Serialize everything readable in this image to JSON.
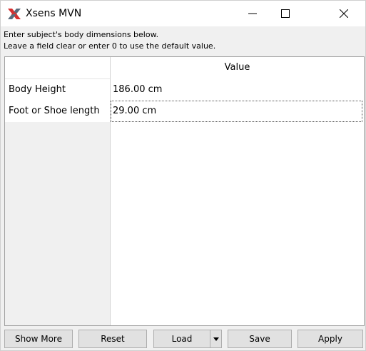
{
  "window": {
    "title": "Xsens MVN",
    "logo_icon": "xsens-x-logo",
    "controls": [
      "minimize-icon",
      "maximize-icon",
      "close-icon"
    ]
  },
  "instructions": {
    "line1": "Enter subject's body dimensions below.",
    "line2": "Leave a field clear or enter 0 to use the default value."
  },
  "table": {
    "column_header": "Value",
    "rows": [
      {
        "label": "Body Height",
        "value": "186.00 cm"
      },
      {
        "label": "Foot or Shoe length",
        "value": "29.00 cm"
      }
    ]
  },
  "buttons": {
    "show_more": "Show More",
    "reset": "Reset",
    "load": "Load",
    "save": "Save",
    "apply": "Apply"
  },
  "colors": {
    "logo_red": "#d62f2f",
    "logo_dark": "#5a6b7c"
  }
}
